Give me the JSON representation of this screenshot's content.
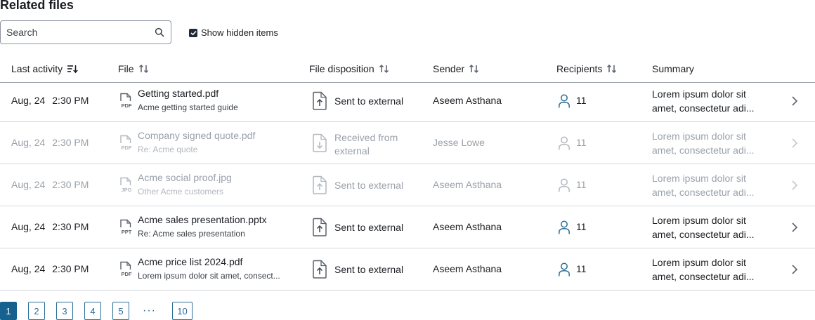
{
  "title": "Related files",
  "search": {
    "placeholder": "Search",
    "value": ""
  },
  "show_hidden": {
    "label": "Show hidden items",
    "checked": true
  },
  "columns": {
    "last_activity": "Last activity",
    "file": "File",
    "file_disposition": "File disposition",
    "sender": "Sender",
    "recipients": "Recipients",
    "summary": "Summary"
  },
  "rows": [
    {
      "date": "Aug, 24",
      "time": "2:30 PM",
      "file_type": "PDF",
      "file_name": "Getting started.pdf",
      "file_subtitle": "Acme getting started guide",
      "disposition_l1": "Sent to external",
      "disposition_l2": "",
      "direction": "sent",
      "sender": "Aseem Asthana",
      "recipients": "11",
      "summary_l1": "Lorem ipsum dolor sit",
      "summary_l2": "amet, consectetur adi...",
      "dimmed": false
    },
    {
      "date": "Aug, 24",
      "time": "2:30 PM",
      "file_type": "PDF",
      "file_name": "Company signed quote.pdf",
      "file_subtitle": "Re: Acme quote",
      "disposition_l1": "Received from",
      "disposition_l2": "external",
      "direction": "received",
      "sender": "Jesse Lowe",
      "recipients": "11",
      "summary_l1": "Lorem ipsum dolor sit",
      "summary_l2": "amet, consectetur adi...",
      "dimmed": true
    },
    {
      "date": "Aug, 24",
      "time": "2:30 PM",
      "file_type": "JPG",
      "file_name": "Acme social proof.jpg",
      "file_subtitle": "Other Acme customers",
      "disposition_l1": "Sent to external",
      "disposition_l2": "",
      "direction": "sent",
      "sender": "Aseem Asthana",
      "recipients": "11",
      "summary_l1": "Lorem ipsum dolor sit",
      "summary_l2": "amet, consectetur adi...",
      "dimmed": true
    },
    {
      "date": "Aug, 24",
      "time": "2:30 PM",
      "file_type": "PPT",
      "file_name": "Acme sales presentation.pptx",
      "file_subtitle": "Re: Acme sales presentation",
      "disposition_l1": "Sent to external",
      "disposition_l2": "",
      "direction": "sent",
      "sender": "Aseem Asthana",
      "recipients": "11",
      "summary_l1": "Lorem ipsum dolor sit",
      "summary_l2": "amet, consectetur adi...",
      "dimmed": false
    },
    {
      "date": "Aug, 24",
      "time": "2:30 PM",
      "file_type": "PDF",
      "file_name": "Acme price list 2024.pdf",
      "file_subtitle": "Lorem ipsum dolor sit amet, consect...",
      "disposition_l1": "Sent to external",
      "disposition_l2": "",
      "direction": "sent",
      "sender": "Aseem Asthana",
      "recipients": "11",
      "summary_l1": "Lorem ipsum dolor sit",
      "summary_l2": "amet, consectetur adi...",
      "dimmed": false
    }
  ],
  "pagination": {
    "pages": [
      "1",
      "2",
      "3",
      "4",
      "5"
    ],
    "ellipsis": "···",
    "last": "10",
    "current": "1"
  },
  "icons": {
    "search": "search-icon",
    "sort_active": "sort-descending-icon",
    "sort": "sort-arrows-icon",
    "file": "file-type-icon",
    "disposition_sent": "file-upload-icon",
    "disposition_received": "file-download-icon",
    "recipients": "person-icon",
    "row_action": "chevron-right-icon"
  },
  "colors": {
    "accent": "#17618f",
    "text": "#1b1e23",
    "muted": "#9aa1aa",
    "border": "#d3d7dc"
  }
}
